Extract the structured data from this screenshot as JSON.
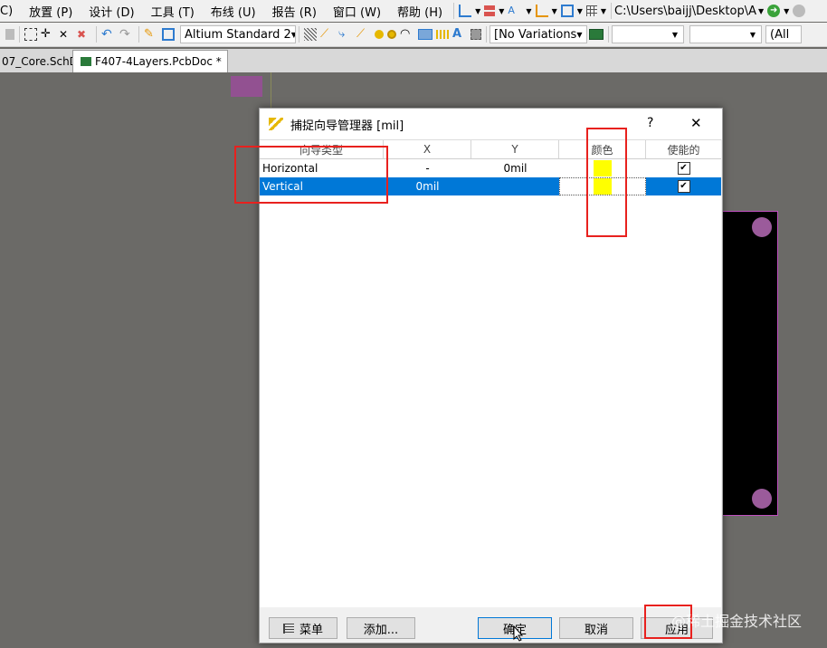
{
  "menu": {
    "items": [
      "C)",
      "放置 (P)",
      "设计 (D)",
      "工具 (T)",
      "布线 (U)",
      "报告 (R)",
      "窗口 (W)",
      "帮助 (H)"
    ],
    "path": "C:\\Users\\baijj\\Desktop\\A"
  },
  "toolbar": {
    "standard_combo": "Altium Standard 2",
    "variations_combo": "[No Variations",
    "all_combo": "(All"
  },
  "tabs": [
    {
      "label": "07_Core.SchDoc",
      "active": false
    },
    {
      "label": "F407-4Layers.PcbDoc *",
      "active": true
    }
  ],
  "dialog": {
    "title": "捕捉向导管理器 [mil]",
    "help": "?",
    "close": "✕",
    "columns": [
      "向导类型",
      "X",
      "Y",
      "颜色",
      "使能的"
    ],
    "rows": [
      {
        "type": "Horizontal",
        "x": "-",
        "y": "0mil",
        "color": "#ffff00",
        "enabled": true,
        "selected": false
      },
      {
        "type": "Vertical",
        "x": "0mil",
        "y": "",
        "color": "#ffff00",
        "enabled": true,
        "selected": true
      }
    ],
    "buttons": {
      "menu": "菜单",
      "add": "添加...",
      "ok": "确定",
      "cancel": "取消",
      "apply": "应用"
    }
  },
  "watermark": "@稀土掘金技术社区",
  "colors": {
    "highlight": "#e8211e",
    "selection": "#0078d7",
    "guide": "#ffff00"
  }
}
